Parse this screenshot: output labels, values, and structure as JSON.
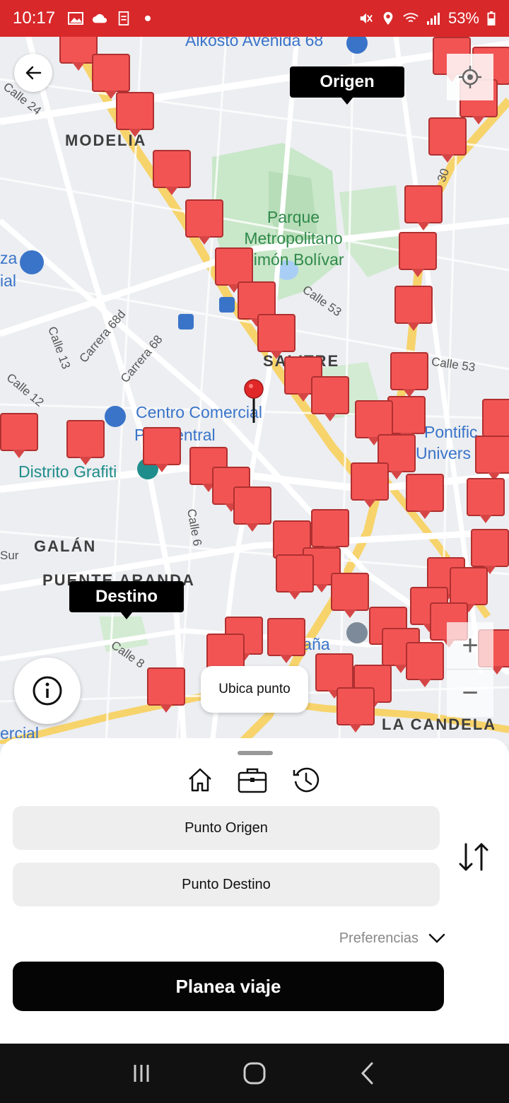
{
  "status_bar": {
    "time": "10:17",
    "battery": "53%",
    "icons": [
      "gallery-icon",
      "cloud-icon",
      "doc-icon",
      "dot-icon",
      "mute-icon",
      "location-icon",
      "wifi-icon",
      "signal-icon",
      "battery-icon"
    ],
    "background": "#d8282a"
  },
  "map": {
    "origin_label": "Origen",
    "destination_label": "Destino",
    "places": {
      "modelia": "MODELIA",
      "parque": "Parque\nMetropolitano\nSimón Bolívar",
      "centro_comercial": "Centro Comercial",
      "centro_comercial_2": "P    Central",
      "distrito": "Distrito Grafiti",
      "galan": "GALÁN",
      "puente_aranda": "PUENTE ARANDA",
      "la_candelaria": "LA CANDELA",
      "salitre": "SALITRE",
      "alkosto": "Alkosto Avenida 68",
      "pontificia": "Pontific",
      "pontificia_2": "Univers",
      "espana": "spaña",
      "sur": "Sur",
      "comercial_left": "ercial",
      "ciza": "za",
      "cial": "ial"
    },
    "streets": {
      "calle24": "Calle 24",
      "calle53": "Calle 53",
      "calle53b": "Calle 53",
      "carrera68d": "Carrera 68d",
      "carrera68": "Carrera 68",
      "calle13": "Calle 13",
      "calle12": "Calle 12",
      "calle6": "Calle 6",
      "calle8": "Calle 8",
      "n30": "30"
    },
    "marker_color": "#f25454"
  },
  "controls": {
    "back": "back-arrow-icon",
    "locate": "crosshair-icon",
    "zoom_in": "+",
    "zoom_out": "−",
    "info": "info-icon",
    "ubica_punto": "Ubica punto"
  },
  "sheet": {
    "shortcuts": [
      "home-icon",
      "briefcase-icon",
      "history-icon"
    ],
    "origin_placeholder": "Punto Origen",
    "destination_placeholder": "Punto Destino",
    "preferences": "Preferencias",
    "plan_button": "Planea viaje"
  },
  "navbar": {
    "buttons": [
      "recents-icon",
      "home-nav-icon",
      "back-nav-icon"
    ]
  }
}
